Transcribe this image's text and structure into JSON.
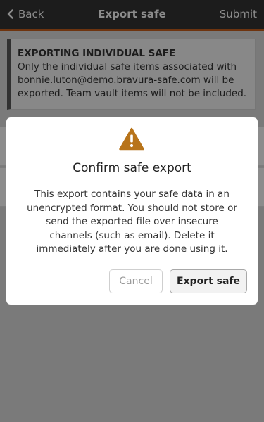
{
  "navbar": {
    "back_label": "Back",
    "title": "Export safe",
    "submit_label": "Submit",
    "accent_color": "#c8601c"
  },
  "callout": {
    "title": "EXPORTING INDIVIDUAL SAFE",
    "text": "Only the individual safe items associated with bonnie.luton@demo.bravura-safe.com will be exported. Team vault items will not be included."
  },
  "modal": {
    "icon": "warning-triangle-icon",
    "icon_color": "#b8741a",
    "title": "Confirm safe export",
    "body": "This export contains your safe data in an unencrypted format. You should not store or send the exported file over insecure channels (such as email). Delete it immediately after you are done using it.",
    "cancel_label": "Cancel",
    "confirm_label": "Export safe"
  }
}
